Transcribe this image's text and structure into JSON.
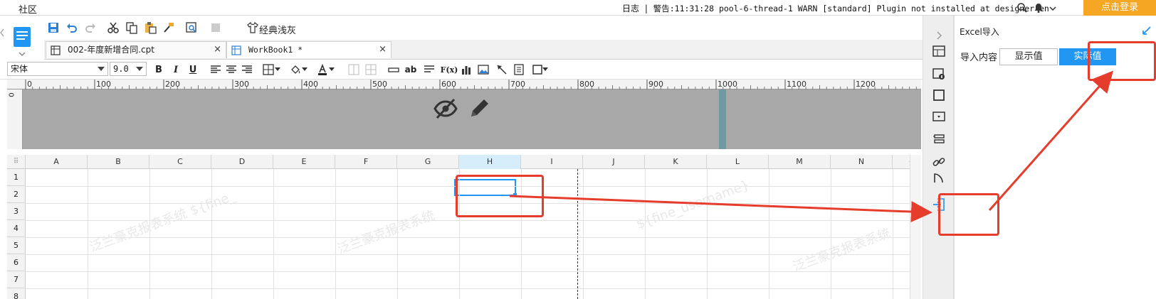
{
  "topbar": {
    "community": "社区",
    "log_label": "日志",
    "separator": "|",
    "warning_text": "警告:11:31:28 pool-6-thread-1 WARN [standard] Plugin not installed at designer end.Plugin ...",
    "login_button": "点击登录"
  },
  "toolbar": {
    "theme_label": "经典浅灰"
  },
  "tabs": [
    {
      "label": "002-年度新增合同.cpt",
      "close": "×"
    },
    {
      "label": "WorkBook1 *",
      "close": "×"
    }
  ],
  "format": {
    "font_name": "宋体",
    "font_size": "9.0",
    "bold": "B",
    "italic": "I",
    "underline": "U",
    "text_tool": "ab",
    "formula_tool": "F(x)"
  },
  "ruler": {
    "ticks": [
      "0",
      "100",
      "200",
      "300",
      "400",
      "500",
      "600",
      "700",
      "800",
      "900",
      "1000",
      "1100",
      "1200"
    ],
    "vertical_zero": "0"
  },
  "grid": {
    "columns": [
      "A",
      "B",
      "C",
      "D",
      "E",
      "F",
      "G",
      "H",
      "I",
      "J",
      "K",
      "L",
      "M",
      "N"
    ],
    "rows": [
      "1",
      "2",
      "3",
      "4",
      "5",
      "6",
      "7",
      "8"
    ],
    "selected_column": "H",
    "selected_cell": "H2",
    "watermark_lines": [
      "泛兰豪克报表系统 ${fine_",
      "泛兰豪克报表系统",
      "${fine_username}",
      "泛兰豪克报表系统"
    ]
  },
  "panel": {
    "title": "Excel导入",
    "import_content_label": "导入内容",
    "display_value_button": "显示值",
    "actual_value_button": "实际值"
  },
  "colors": {
    "accent_blue": "#2196f3",
    "login_orange": "#f5a623",
    "highlight_red": "#e53c2b",
    "design_gray": "#a8a8a8"
  }
}
